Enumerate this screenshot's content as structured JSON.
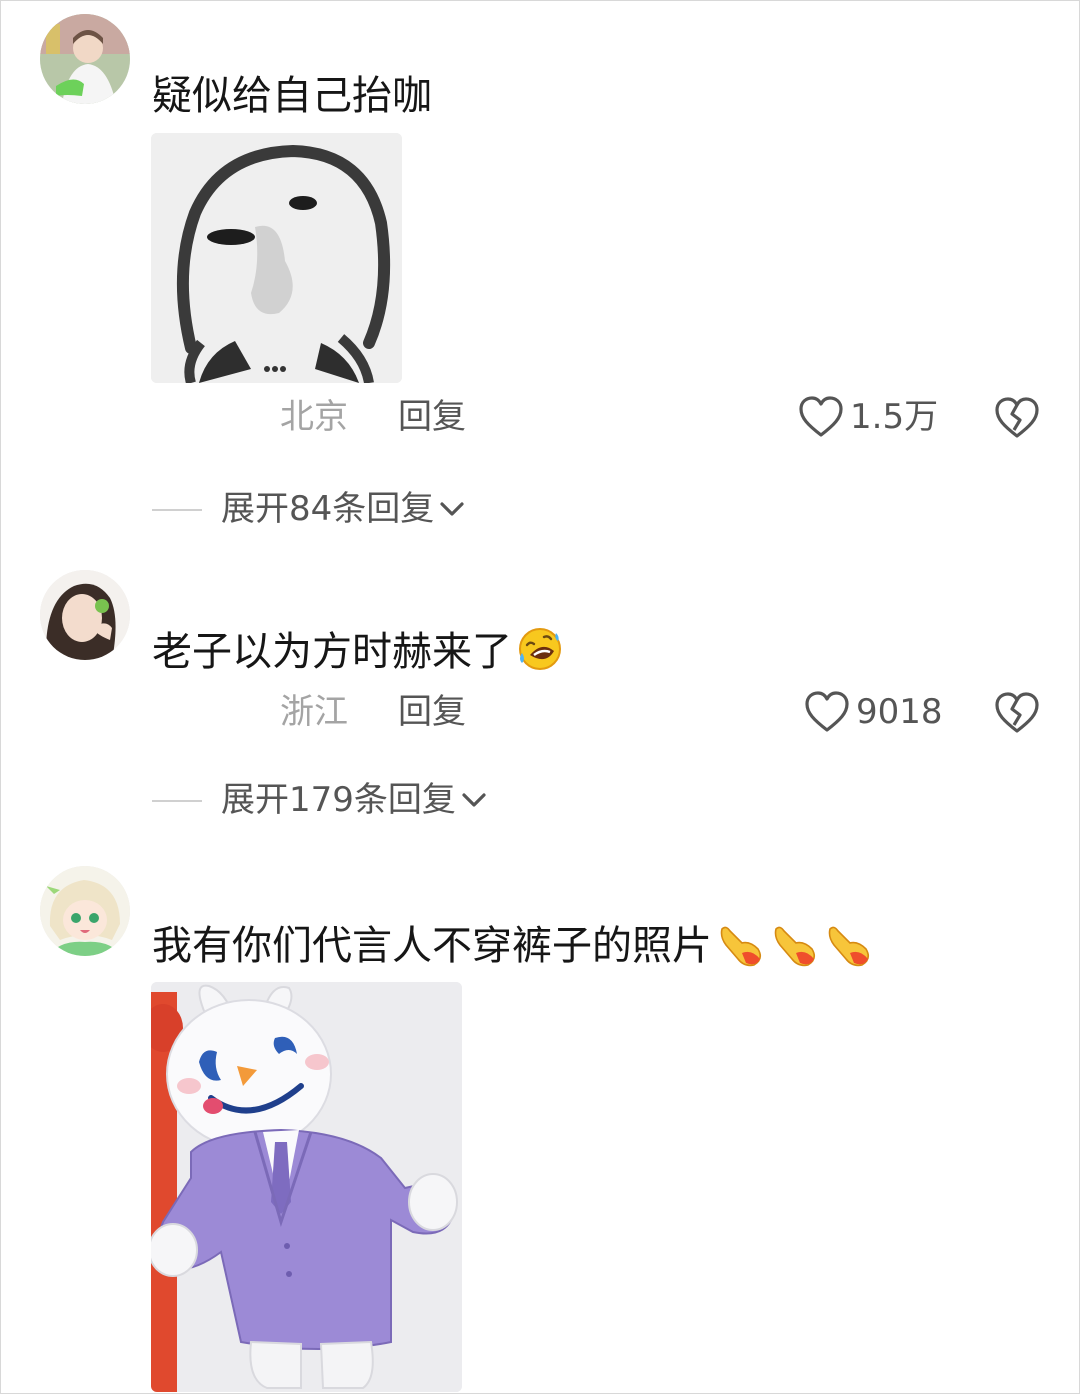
{
  "comments": [
    {
      "text": "疑似给自己抬咖",
      "location": "北京",
      "reply_label": "回复",
      "likes": "1.5万",
      "expand_label": "展开84条回复",
      "avatar_icon": "avatar-girl-photo",
      "image_icon": "sketch-face-meme"
    },
    {
      "text": "老子以为方时赫来了",
      "emoji": "rolling-laughing-emoji",
      "location": "浙江",
      "reply_label": "回复",
      "likes": "9018",
      "expand_label": "展开179条回复",
      "avatar_icon": "avatar-girl-photo"
    },
    {
      "text": "我有你们代言人不穿裤子的照片",
      "emoji": "pointing-hand-emoji",
      "avatar_icon": "avatar-anime-girl",
      "image_icon": "bunny-mascot-purple-suit"
    }
  ],
  "colors": {
    "text": "#161616",
    "secondary": "#555555",
    "muted": "#a4a4a4",
    "suit": "#9c8ad6",
    "pole": "#e0492e"
  }
}
